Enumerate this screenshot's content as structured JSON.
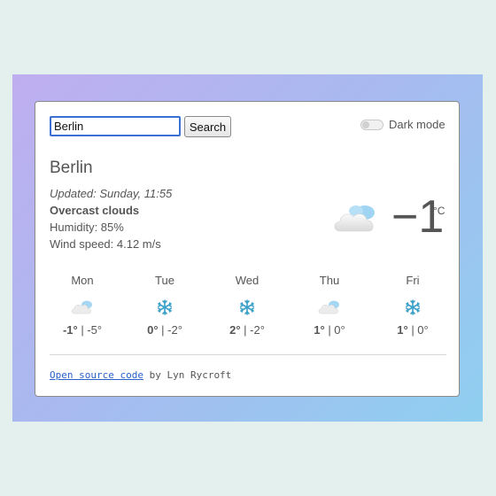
{
  "search": {
    "value": "Berlin",
    "button_label": "Search"
  },
  "dark_mode": {
    "label": "Dark mode",
    "enabled": false
  },
  "current": {
    "city": "Berlin",
    "updated": "Updated: Sunday, 11:55",
    "description": "Overcast clouds",
    "humidity": "Humidity: 85%",
    "wind": "Wind speed: 4.12 m/s",
    "temperature": "−1",
    "unit": "°C",
    "icon": "cloud-icon"
  },
  "forecast": [
    {
      "day": "Mon",
      "icon": "cloud-icon",
      "max": "-1°",
      "min": " | -5°"
    },
    {
      "day": "Tue",
      "icon": "snowflake-icon",
      "max": "0°",
      "min": " | -2°"
    },
    {
      "day": "Wed",
      "icon": "snowflake-icon",
      "max": "2°",
      "min": " | -2°"
    },
    {
      "day": "Thu",
      "icon": "cloud-icon",
      "max": "1°",
      "min": " | 0°"
    },
    {
      "day": "Fri",
      "icon": "snowflake-icon",
      "max": "1°",
      "min": " | 0°"
    }
  ],
  "footer": {
    "link_text": "Open source code",
    "suffix": " by Lyn Rycroft"
  },
  "colors": {
    "accent": "#3b6fd1",
    "link": "#2a62c9",
    "snow": "#3aa0c8"
  }
}
